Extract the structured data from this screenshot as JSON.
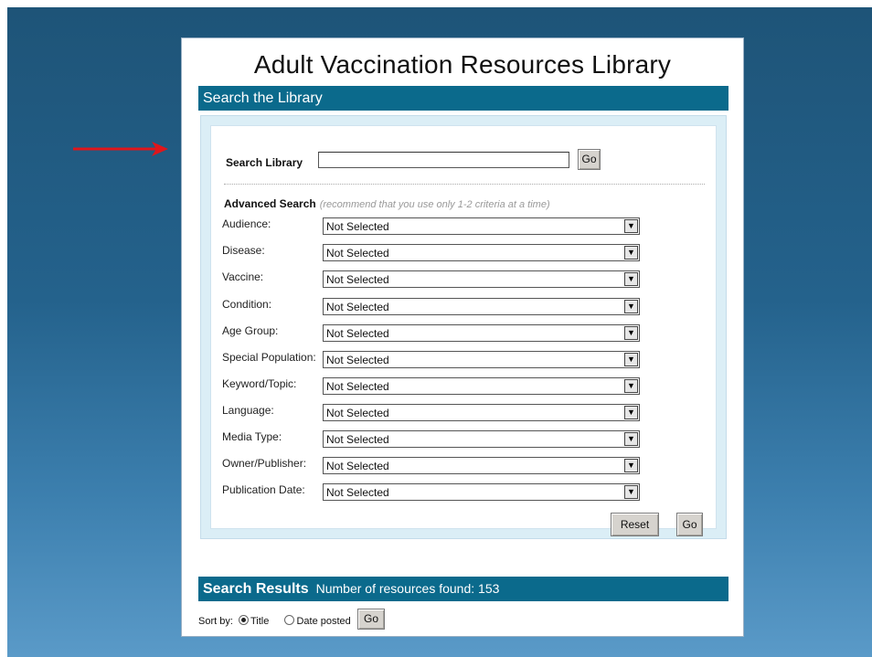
{
  "title": "Adult Vaccination Resources Library",
  "search_section": {
    "heading": "Search the Library",
    "search_label": "Search Library",
    "search_value": "",
    "go_label": "Go"
  },
  "advanced": {
    "heading": "Advanced Search",
    "note": "(recommend that you use only 1-2 criteria at a time)",
    "fields": [
      {
        "label": "Audience:",
        "value": "Not Selected"
      },
      {
        "label": "Disease:",
        "value": "Not Selected"
      },
      {
        "label": "Vaccine:",
        "value": "Not Selected"
      },
      {
        "label": "Condition:",
        "value": "Not Selected"
      },
      {
        "label": "Age Group:",
        "value": "Not Selected"
      },
      {
        "label": "Special Population:",
        "value": "Not Selected"
      },
      {
        "label": "Keyword/Topic:",
        "value": "Not Selected"
      },
      {
        "label": "Language:",
        "value": "Not Selected"
      },
      {
        "label": "Media Type:",
        "value": "Not Selected"
      },
      {
        "label": "Owner/Publisher:",
        "value": "Not Selected"
      },
      {
        "label": "Publication Date:",
        "value": "Not Selected"
      }
    ],
    "reset_label": "Reset",
    "go_label": "Go"
  },
  "results": {
    "heading": "Search Results",
    "count_text": "Number of resources found: 153"
  },
  "sort": {
    "label": "Sort by:",
    "options": [
      "Title",
      "Date posted"
    ],
    "selected": "Title",
    "go_label": "Go"
  },
  "colors": {
    "accent_bar": "#0b6a8c",
    "arrow": "#e0161b"
  }
}
